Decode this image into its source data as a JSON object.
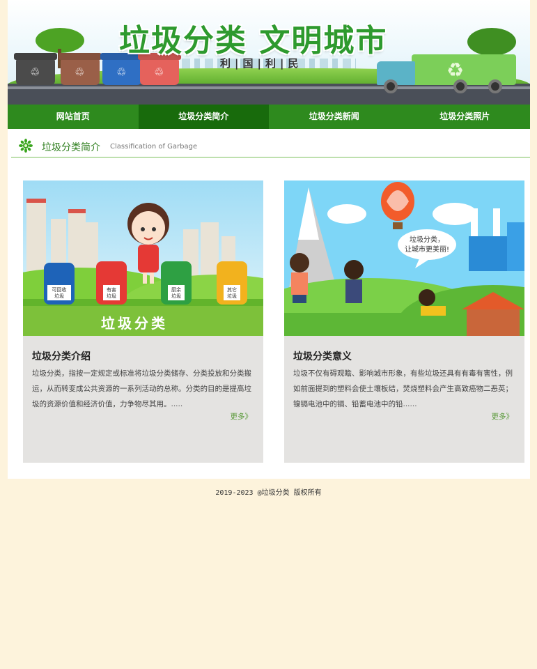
{
  "banner": {
    "title": "垃圾分类  文明城市",
    "subtitle": "利|国|利|民",
    "bins": [
      {
        "color": "#4b4b4b",
        "icon": "recycle-icon"
      },
      {
        "color": "#9a5f48",
        "icon": "recycle-icon"
      },
      {
        "color": "#2f6fc4",
        "icon": "recycle-icon"
      },
      {
        "color": "#e5625c",
        "icon": "recycle-icon"
      }
    ]
  },
  "nav": {
    "items": [
      {
        "label": "网站首页"
      },
      {
        "label": "垃圾分类简介"
      },
      {
        "label": "垃圾分类新闻"
      },
      {
        "label": "垃圾分类照片"
      }
    ],
    "active_index": 1
  },
  "section": {
    "title": "垃圾分类简介",
    "title_en": "Classification of Garbage",
    "icon": "green-flower-icon"
  },
  "cards": [
    {
      "image_caption": "垃圾分类",
      "bin_labels": [
        "可回收\n垃圾",
        "有害\n垃圾",
        "厨余\n垃圾",
        "其它\n垃圾"
      ],
      "title": "垃圾分类介绍",
      "text": "垃圾分类，指按一定规定或标准将垃圾分类储存、分类投放和分类搬运，从而转变成公共资源的一系列活动的总称。分类的目的是提高垃圾的资源价值和经济价值，力争物尽其用。.....",
      "more": "更多》"
    },
    {
      "image_speech": "垃圾分类，\n让城市更美丽!",
      "title": "垃圾分类意义",
      "text": "垃圾不仅有碍观瞻、影响城市形象，有些垃圾还具有有毒有害性，例如前面提到的塑料会使土壤板结，焚烧塑料会产生高致癌物二恶英；镍镉电池中的镉、铅蓄电池中的铅......",
      "more": "更多》"
    }
  ],
  "footer": {
    "text": "2019-2023 @垃圾分类 版权所有"
  },
  "colors": {
    "nav_bg": "#2e8a1e",
    "nav_active": "#186b0c",
    "page_bg": "#fdf3dc",
    "card_bg": "#e4e3e1",
    "accent_green": "#2f7f1f"
  }
}
